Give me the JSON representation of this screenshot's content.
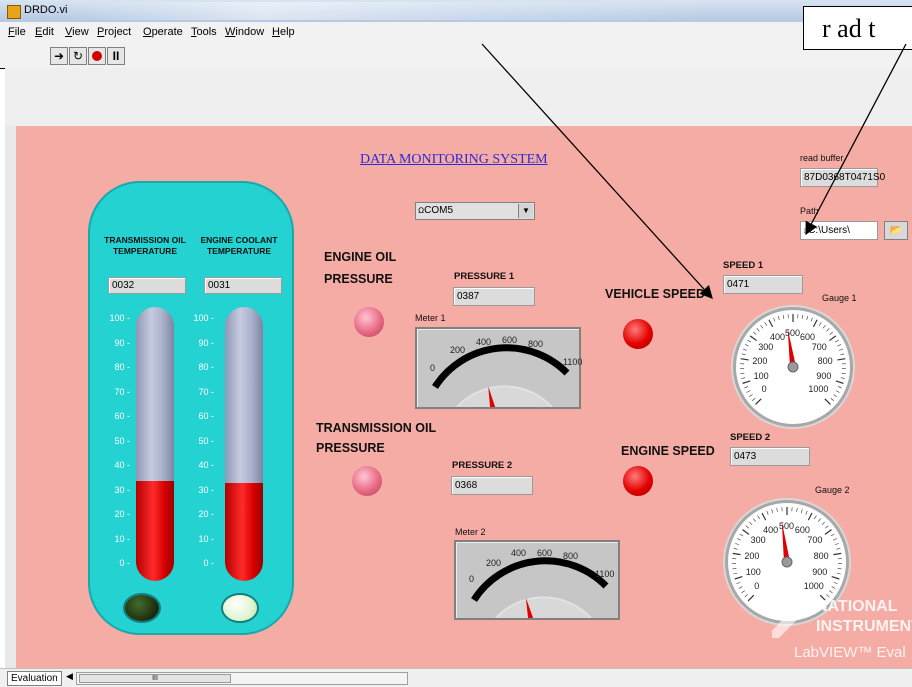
{
  "window": {
    "title": "DRDO.vi"
  },
  "annotation": {
    "text": "r ad t"
  },
  "menu": [
    {
      "label": "File",
      "key": "F"
    },
    {
      "label": "Edit",
      "key": "E"
    },
    {
      "label": "View",
      "key": "V"
    },
    {
      "label": "Project",
      "key": "P"
    },
    {
      "label": "Operate",
      "key": "O"
    },
    {
      "label": "Tools",
      "key": "T"
    },
    {
      "label": "Window",
      "key": "W"
    },
    {
      "label": "Help",
      "key": "H"
    }
  ],
  "toolbar": {
    "icons": [
      "run-icon",
      "run-continuously-icon",
      "abort-icon",
      "pause-icon"
    ]
  },
  "panel": {
    "title": "DATA MONITORING SYSTEM",
    "com_port": "COM5",
    "read_buffer": {
      "label": "read buffer",
      "value": "87D0368T0471S0"
    },
    "path": {
      "label": "Path",
      "value": "C:\\Users\\"
    },
    "thermometers": [
      {
        "label": "TRANSMISSION OIL TEMPERATURE",
        "value": "0032",
        "level": 32
      },
      {
        "label": "ENGINE COOLANT TEMPERATURE",
        "value": "0031",
        "level": 31
      }
    ],
    "thermo_scale": [
      "100",
      "90",
      "80",
      "70",
      "60",
      "50",
      "40",
      "30",
      "20",
      "10",
      "0"
    ],
    "engine_oil_pressure_label": "ENGINE OIL PRESSURE",
    "transmission_oil_pressure_label": "TRANSMISSION OIL PRESSURE",
    "pressure1": {
      "label": "PRESSURE 1",
      "value": "0387"
    },
    "pressure2": {
      "label": "PRESSURE 2",
      "value": "0368"
    },
    "meter1": {
      "label": "Meter 1",
      "scale": [
        "0",
        "200",
        "400",
        "600",
        "800",
        "1100"
      ],
      "needle": 387
    },
    "meter2": {
      "label": "Meter 2",
      "scale": [
        "0",
        "200",
        "400",
        "600",
        "800",
        "1100"
      ],
      "needle": 368
    },
    "vehicle_speed_label": "VEHICLE SPEED",
    "engine_speed_label": "ENGINE SPEED",
    "speed1": {
      "label": "SPEED 1",
      "value": "0471"
    },
    "speed2": {
      "label": "SPEED 2",
      "value": "0473"
    },
    "gauge1": {
      "label": "Gauge 1",
      "needle": 471
    },
    "gauge2": {
      "label": "Gauge 2",
      "needle": 473
    },
    "gauge_scale": [
      "0",
      "100",
      "200",
      "300",
      "400",
      "500",
      "600",
      "700",
      "800",
      "900",
      "1000"
    ],
    "watermark": {
      "line1": "NATIONAL",
      "line2": "INSTRUMENTS",
      "line3": "LabVIEW™ Eval"
    }
  },
  "status": {
    "evaluation_label": "Evaluation",
    "scroll_label": "III"
  },
  "colors": {
    "panel": "#f5aca4",
    "thermo_box": "#24d2d2",
    "led_red": "#e30000",
    "led_pink": "#e86a85",
    "title_link": "#2b2bd6"
  }
}
